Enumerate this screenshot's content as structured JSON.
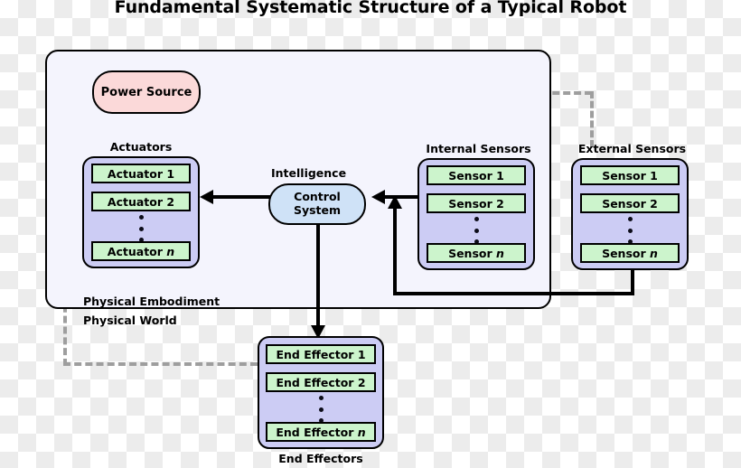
{
  "title": "Fundamental Systematic Structure of a Typical Robot",
  "zones": {
    "physical_embodiment": "Physical Embodiment",
    "physical_world": "Physical World"
  },
  "power_source": {
    "label": "Power Source",
    "color": "#fbd9d9"
  },
  "control_system": {
    "label_line1": "Control",
    "label_line2": "System",
    "caption": "Intelligence",
    "color": "#cfe2f7"
  },
  "groups": {
    "actuators": {
      "label": "Actuators",
      "label_position": "above",
      "items": [
        "Actuator 1",
        "Actuator 2",
        "Actuator n"
      ],
      "italic_last_token": "n",
      "ellipsis": "vertical-dots",
      "container_color": "#ccccf4",
      "item_color": "#ccf4cc"
    },
    "internal_sensors": {
      "label": "Internal Sensors",
      "label_position": "above",
      "items": [
        "Sensor 1",
        "Sensor 2",
        "Sensor n"
      ],
      "italic_last_token": "n",
      "ellipsis": "vertical-dots",
      "container_color": "#ccccf4",
      "item_color": "#ccf4cc"
    },
    "external_sensors": {
      "label": "External Sensors",
      "label_position": "above",
      "items": [
        "Sensor 1",
        "Sensor 2",
        "Sensor n"
      ],
      "italic_last_token": "n",
      "ellipsis": "vertical-dots",
      "container_color": "#ccccf4",
      "item_color": "#ccf4cc"
    },
    "end_effectors": {
      "label": "End Effectors",
      "label_position": "below",
      "items": [
        "End Effector 1",
        "End Effector 2",
        "End Effector n"
      ],
      "italic_last_token": "n",
      "ellipsis": "vertical-dots",
      "container_color": "#ccccf4",
      "item_color": "#ccf4cc"
    }
  },
  "connections": [
    {
      "from": "control_system",
      "to": "actuators",
      "direction": "left"
    },
    {
      "from": "control_system",
      "to": "end_effectors",
      "direction": "down"
    },
    {
      "from": "internal_sensors",
      "to": "control_system",
      "direction": "left"
    },
    {
      "from": "external_sensors",
      "to": "control_system",
      "direction": "up-left"
    }
  ],
  "style": {
    "solid_boundary_color": "#000000",
    "dashed_boundary_color": "#9e9e9e",
    "panel_background": "#f4f4fd"
  }
}
